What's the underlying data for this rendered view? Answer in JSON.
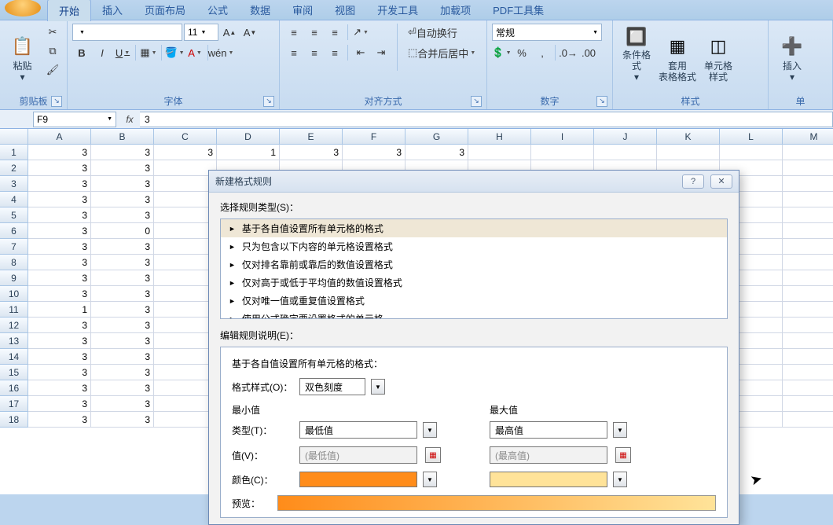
{
  "tabs": [
    "开始",
    "插入",
    "页面布局",
    "公式",
    "数据",
    "审阅",
    "视图",
    "开发工具",
    "加载项",
    "PDF工具集"
  ],
  "groups": {
    "clipboard": {
      "paste": "粘贴",
      "label": "剪贴板"
    },
    "font": {
      "label": "字体",
      "size": "11",
      "bold": "B",
      "italic": "I",
      "underline": "U"
    },
    "alignment": {
      "label": "对齐方式",
      "wrap": "自动换行",
      "merge": "合并后居中"
    },
    "number": {
      "label": "数字",
      "format": "常规"
    },
    "styles": {
      "label": "样式",
      "cf": "条件格式",
      "fat": "套用\n表格格式",
      "cs": "单元格\n样式"
    },
    "cells": {
      "insert": "插入",
      "label": "单"
    }
  },
  "namebox": "F9",
  "formula": "3",
  "cols": [
    "A",
    "B",
    "C",
    "D",
    "E",
    "F",
    "G",
    "H",
    "I",
    "J",
    "K",
    "L",
    "M"
  ],
  "rows": 18,
  "datacols": {
    "A": [
      3,
      3,
      3,
      3,
      3,
      3,
      3,
      3,
      3,
      3,
      1,
      3,
      3,
      3,
      3,
      3,
      3,
      3
    ],
    "B": [
      3,
      3,
      3,
      3,
      3,
      0,
      3,
      3,
      3,
      3,
      3,
      3,
      3,
      3,
      3,
      3,
      3,
      3
    ],
    "C": [
      3,
      "",
      "",
      "",
      "",
      "",
      "",
      "",
      "",
      "",
      "",
      "",
      "",
      "",
      "",
      "",
      "",
      ""
    ],
    "D": [
      1,
      "",
      "",
      "",
      "",
      "",
      "",
      "",
      "",
      "",
      "",
      "",
      "",
      "",
      "",
      "",
      "",
      ""
    ],
    "E": [
      3,
      "",
      "",
      "",
      "",
      "",
      "",
      "",
      "",
      "",
      "",
      "",
      "",
      "",
      "",
      "",
      "",
      ""
    ],
    "F": [
      3,
      "",
      "",
      "",
      "",
      "",
      "",
      "",
      "",
      "",
      "",
      "",
      "",
      "",
      "",
      "",
      "",
      ""
    ],
    "G": [
      3,
      "",
      "",
      "",
      "",
      "",
      "",
      "",
      "",
      "",
      "",
      "",
      "",
      "",
      "",
      "",
      "",
      ""
    ]
  },
  "dialog": {
    "title": "新建格式规则",
    "select_label": "选择规则类型(S)：",
    "rules": [
      "基于各自值设置所有单元格的格式",
      "只为包含以下内容的单元格设置格式",
      "仅对排名靠前或靠后的数值设置格式",
      "仅对高于或低于平均值的数值设置格式",
      "仅对唯一值或重复值设置格式",
      "使用公式确定要设置格式的单元格"
    ],
    "edit_label": "编辑规则说明(E)：",
    "desc_header": "基于各自值设置所有单元格的格式：",
    "style_label": "格式样式(O)：",
    "style_value": "双色刻度",
    "min_header": "最小值",
    "max_header": "最大值",
    "type_label": "类型(T)：",
    "type_min": "最低值",
    "type_max": "最高值",
    "value_label": "值(V)：",
    "value_min": "(最低值)",
    "value_max": "(最高值)",
    "color_label": "颜色(C)：",
    "preview_label": "预览：",
    "min_color": "#ff8c1a",
    "max_color": "#ffe399"
  }
}
